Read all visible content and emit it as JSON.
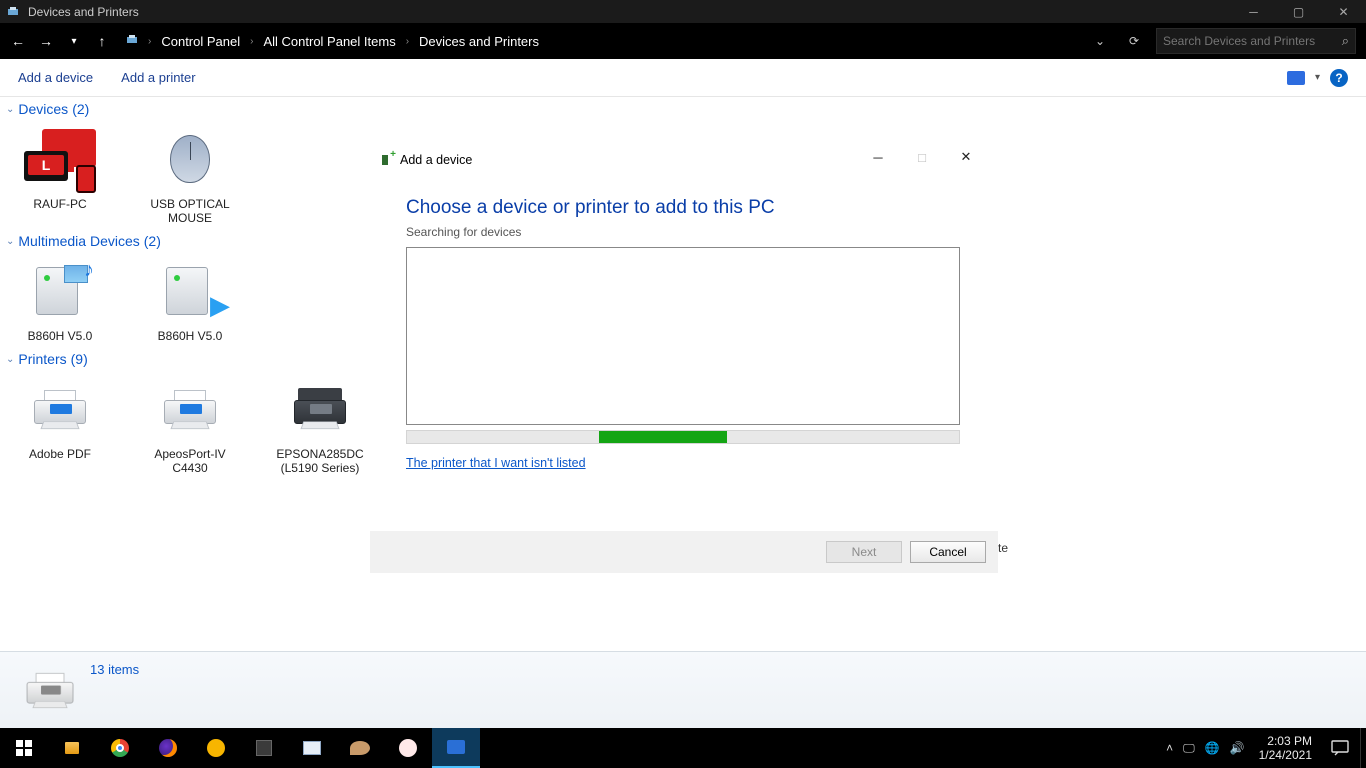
{
  "window": {
    "title": "Devices and Printers"
  },
  "breadcrumb": {
    "a": "Control Panel",
    "b": "All Control Panel Items",
    "c": "Devices and Printers"
  },
  "search": {
    "placeholder": "Search Devices and Printers"
  },
  "commands": {
    "add_device": "Add a device",
    "add_printer": "Add a printer"
  },
  "sections": {
    "devices": {
      "title": "Devices",
      "count": "(2)",
      "items": [
        "RAUF-PC",
        "USB OPTICAL MOUSE"
      ]
    },
    "multimedia": {
      "title": "Multimedia Devices",
      "count": "(2)",
      "items": [
        "B860H V5.0",
        "B860H V5.0"
      ]
    },
    "printers": {
      "title": "Printers",
      "count": "(9)",
      "items": [
        "Adobe PDF",
        "ApeosPort-IV C4430",
        "EPSONA285DC (L5190 Series)"
      ]
    }
  },
  "status": {
    "items": "13 items"
  },
  "dialog": {
    "title": "Add a device",
    "heading": "Choose a device or printer to add to this PC",
    "subheading": "Searching for devices",
    "link": "The printer that I want isn't listed",
    "next": "Next",
    "cancel": "Cancel"
  },
  "behind": {
    "te": "te"
  },
  "tray": {
    "time": "2:03 PM",
    "date": "1/24/2021"
  }
}
